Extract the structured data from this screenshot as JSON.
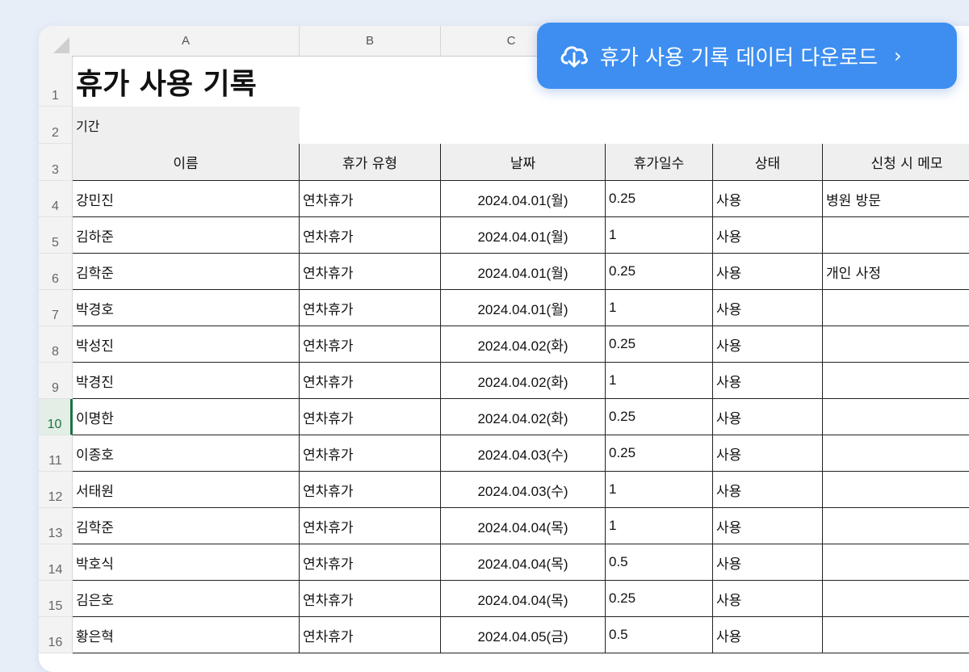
{
  "download_button": {
    "label": "휴가 사용 기록 데이터 다운로드",
    "chevron": "›",
    "icon": "cloud-download-icon"
  },
  "columns": [
    "A",
    "B",
    "C"
  ],
  "row_numbers": [
    "1",
    "2",
    "3",
    "4",
    "5",
    "6",
    "7",
    "8",
    "9",
    "10",
    "11",
    "12",
    "13",
    "14",
    "15",
    "16"
  ],
  "active_row": "10",
  "sheet": {
    "title": "휴가 사용 기록",
    "period_label": "기간",
    "headers": [
      "이름",
      "휴가 유형",
      "날짜",
      "휴가일수",
      "상태",
      "신청 시 메모"
    ],
    "rows": [
      [
        "강민진",
        "연차휴가",
        "2024.04.01(월)",
        "0.25",
        "사용",
        "병원 방문"
      ],
      [
        "김하준",
        "연차휴가",
        "2024.04.01(월)",
        "1",
        "사용",
        ""
      ],
      [
        "김학준",
        "연차휴가",
        "2024.04.01(월)",
        "0.25",
        "사용",
        "개인 사정"
      ],
      [
        "박경호",
        "연차휴가",
        "2024.04.01(월)",
        "1",
        "사용",
        ""
      ],
      [
        "박성진",
        "연차휴가",
        "2024.04.02(화)",
        "0.25",
        "사용",
        ""
      ],
      [
        "박경진",
        "연차휴가",
        "2024.04.02(화)",
        "1",
        "사용",
        ""
      ],
      [
        "이명한",
        "연차휴가",
        "2024.04.02(화)",
        "0.25",
        "사용",
        ""
      ],
      [
        "이종호",
        "연차휴가",
        "2024.04.03(수)",
        "0.25",
        "사용",
        ""
      ],
      [
        "서태원",
        "연차휴가",
        "2024.04.03(수)",
        "1",
        "사용",
        ""
      ],
      [
        "김학준",
        "연차휴가",
        "2024.04.04(목)",
        "1",
        "사용",
        ""
      ],
      [
        "박호식",
        "연차휴가",
        "2024.04.04(목)",
        "0.5",
        "사용",
        ""
      ],
      [
        "김은호",
        "연차휴가",
        "2024.04.04(목)",
        "0.25",
        "사용",
        ""
      ],
      [
        "황은혁",
        "연차휴가",
        "2024.04.05(금)",
        "0.5",
        "사용",
        ""
      ]
    ]
  },
  "colors": {
    "accent": "#3d8ef0",
    "active_row": "#1a7343"
  }
}
